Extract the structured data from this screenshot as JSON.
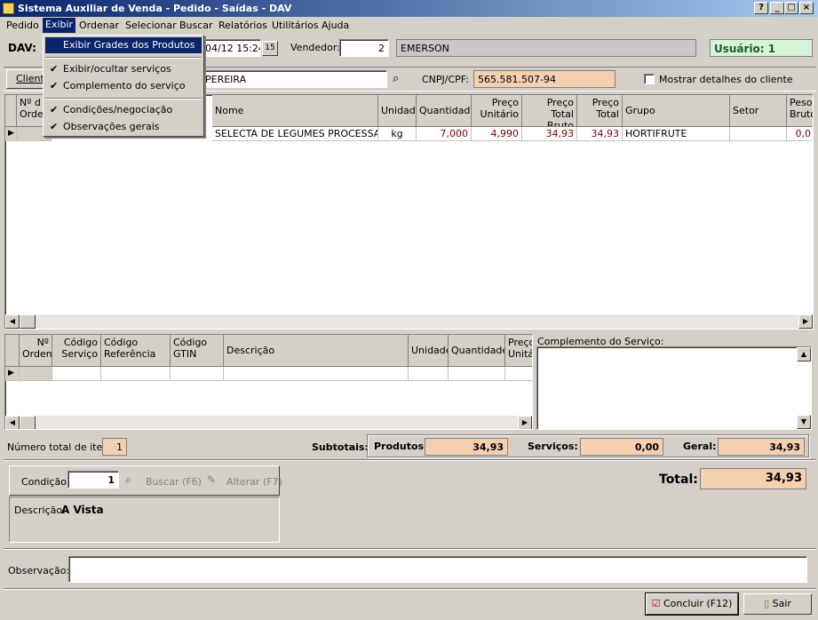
{
  "window": {
    "title": "Sistema Auxiliar de Venda - Pedido - Saídas - DAV"
  },
  "menubar": [
    "Pedido",
    "Exibir",
    "Ordenar",
    "Selecionar",
    "Buscar",
    "Relatórios",
    "Utilitários",
    "Ajuda"
  ],
  "exibir_menu": {
    "items": [
      {
        "label": "Exibir Grades dos Produtos",
        "checked": false
      },
      {
        "label": "Exibir/ocultar serviços",
        "checked": true
      },
      {
        "label": "Complemento do serviço",
        "checked": true
      },
      {
        "label": "Condições/negociação",
        "checked": true
      },
      {
        "label": "Observações gerais",
        "checked": true
      }
    ]
  },
  "header": {
    "dav_label": "DAV:",
    "date_value": "04/12 15:24",
    "vendedor_label": "Vendedor:",
    "vendedor_code": "2",
    "vendedor_name": "EMERSON",
    "usuario": "Usuário: 1",
    "cliente_label": "Cliente",
    "cliente_name": "PEREIRA",
    "cnpj_label": "CNPJ/CPF:",
    "cnpj_value": "565.581.507-94",
    "mostrar_label": "Mostrar detalhes do cliente"
  },
  "products_grid": {
    "headers": [
      "Nº d Orde",
      "",
      "",
      "Nome",
      "Unidade",
      "Quantidade",
      "Preço Unitário",
      "Preço Total Bruto",
      "Preço Total",
      "Grupo",
      "Setor",
      "Peso Bruto"
    ],
    "rows": [
      {
        "nome": "SELECTA DE LEGUMES PROCESSAI",
        "unidade": "kg",
        "quantidade": "7,000",
        "preco_unit": "4,990",
        "total_bruto": "34,93",
        "total": "34,93",
        "grupo": "HORTIFRUTE",
        "setor": "",
        "peso": "0,0"
      }
    ]
  },
  "services_grid": {
    "headers": [
      "Nº Ordem",
      "Código Serviço",
      "Código Referência",
      "Código GTIN",
      "Descrição",
      "Unidade",
      "Quantidade",
      "Preço Unitário"
    ]
  },
  "complemento": {
    "label": "Complemento do Serviço:"
  },
  "totals": {
    "num_itens_label": "Número total de itens:",
    "num_itens": "1",
    "subtotais_label": "Subtotais:",
    "produtos_label": "Produtos:",
    "produtos": "34,93",
    "servicos_label": "Serviços:",
    "servicos": "0,00",
    "geral_label": "Geral:",
    "geral": "34,93",
    "total_label": "Total:",
    "total": "34,93"
  },
  "condicao": {
    "label": "Condição:",
    "value": "1",
    "buscar": "Buscar (F6)",
    "alterar": "Alterar (F7)",
    "descricao_label": "Descrição:",
    "descricao": "A Vista"
  },
  "observacao": {
    "label": "Observação:",
    "value": ""
  },
  "buttons": {
    "concluir": "Concluir (F12)",
    "sair": "Sair"
  },
  "colors": {
    "title_start": "#0a246a",
    "highlight_orange": "#f4cfb0",
    "usuario_bg": "#d6f5d6"
  }
}
